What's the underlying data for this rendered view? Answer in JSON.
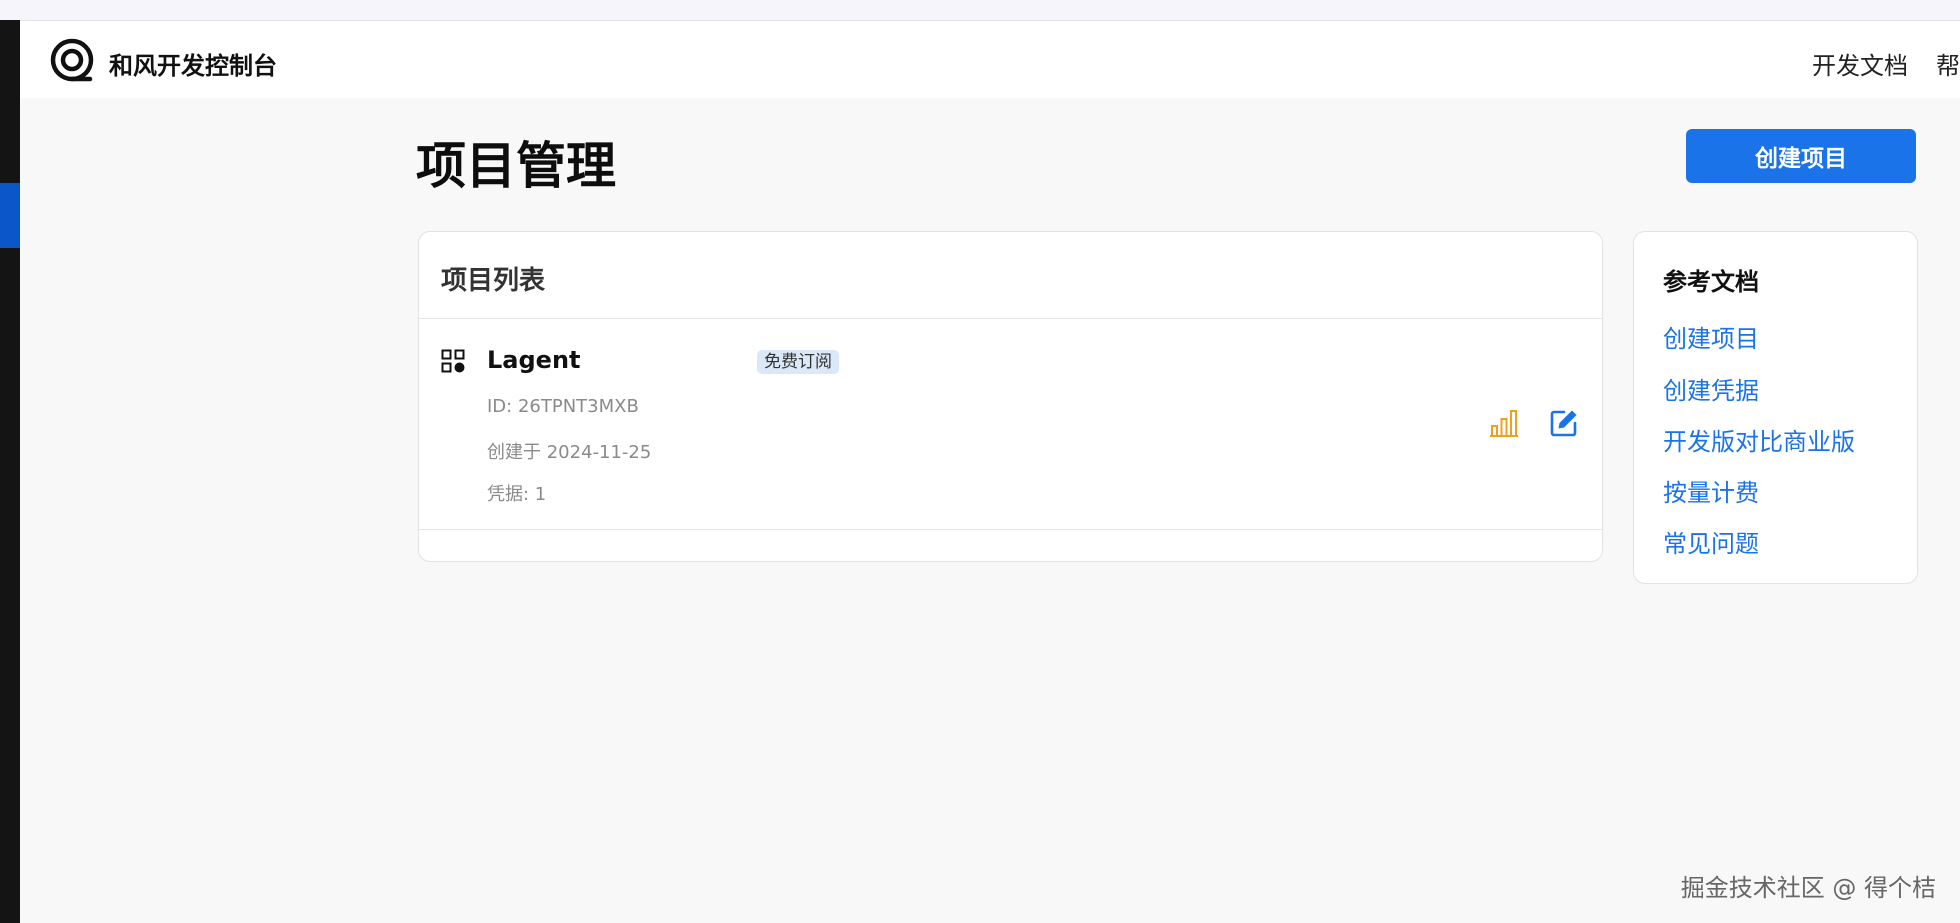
{
  "header": {
    "brand": "和风开发控制台",
    "nav_docs": "开发文档",
    "nav_help": "帮"
  },
  "page": {
    "title": "项目管理",
    "create_button": "创建项目"
  },
  "project_list": {
    "title": "项目列表",
    "projects": [
      {
        "name": "Lagent",
        "badge": "免费订阅",
        "id": "ID: 26TPNT3MXB",
        "created": "创建于 2024-11-25",
        "credentials": "凭据: 1"
      }
    ]
  },
  "reference": {
    "title": "参考文档",
    "links": [
      "创建项目",
      "创建凭据",
      "开发版对比商业版",
      "按量计费",
      "常见问题"
    ]
  },
  "watermark": "掘金技术社区 @ 得个桔",
  "colors": {
    "accent": "#1a73e8",
    "stats_icon": "#f0a020",
    "badge_bg": "#dbe8f8",
    "sidebar": "#141414"
  },
  "icons": [
    "qweather-logo-icon",
    "app-grid-icon",
    "bar-chart-icon",
    "edit-icon"
  ]
}
